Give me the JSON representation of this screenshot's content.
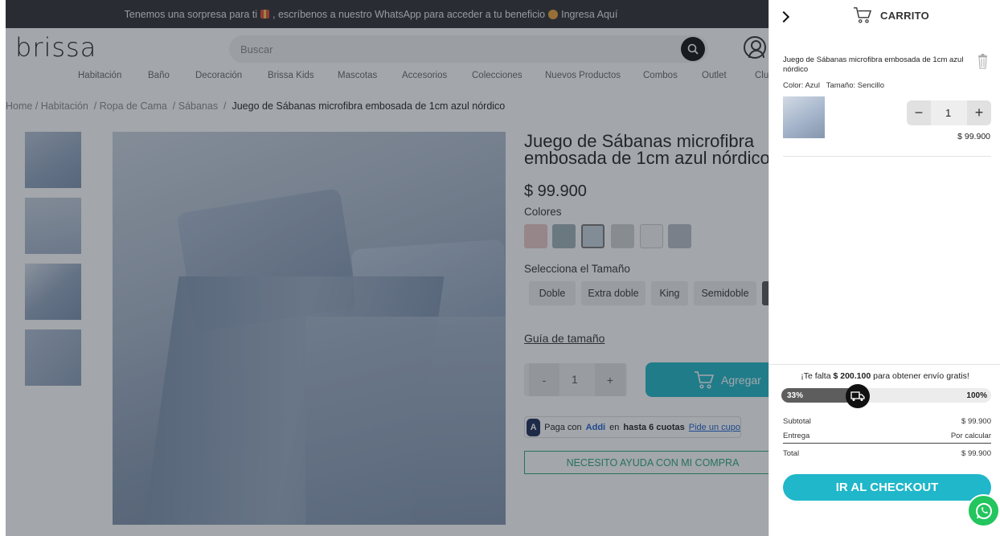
{
  "promo": {
    "text_before": "Tenemos una sorpresa para ti",
    "text_middle": ", escríbenos a nuestro WhatsApp para acceder a tu beneficio",
    "link": "Ingresa Aquí"
  },
  "header": {
    "logo": "brissa",
    "search_placeholder": "Buscar"
  },
  "nav": [
    "Habitación",
    "Baño",
    "Decoración",
    "Brissa Kids",
    "Mascotas",
    "Accesorios",
    "Colecciones",
    "Nuevos Productos",
    "Combos",
    "Outlet",
    "Clu"
  ],
  "breadcrumb": {
    "items": [
      "Home",
      "/ Habitación",
      "/ Ropa de Cama",
      "/ Sábanas",
      "/"
    ],
    "current": "Juego de Sábanas microfibra embosada de 1cm azul nórdico"
  },
  "product": {
    "title": "Juego de Sábanas microfibra embosada de 1cm azul nórdico",
    "price": "$ 99.900",
    "colors_label": "Colores",
    "colors": [
      "#e8c7c7",
      "#9db2b6",
      "#c4d2df",
      "#cfd2d4",
      "#f4f6f8",
      "#b7bec6"
    ],
    "size_label": "Selecciona el Tamaño",
    "sizes": [
      "Doble",
      "Extra doble",
      "King",
      "Semidoble"
    ],
    "size_guide": "Guía de tamaño",
    "qty_minus": "-",
    "qty_value": "1",
    "qty_plus": "+",
    "add_label": "Agregar",
    "addi_prefix": "Paga con",
    "addi_brand": "Addi",
    "addi_mid": "en",
    "addi_bold": "hasta 6 cuotas",
    "addi_link": "Pide un cupo",
    "addi_logo": "A",
    "help": "NECESITO AYUDA CON MI COMPRA"
  },
  "cart": {
    "title": "CARRITO",
    "item_name": "Juego de Sábanas microfibra embosada de 1cm azul nórdico",
    "color_attr": "Color: Azul",
    "size_attr": "Tamaño: Sencillo",
    "qty_minus": "−",
    "qty": "1",
    "qty_plus": "+",
    "line_price": "$ 99.900",
    "ship_prefix": "¡Te falta",
    "ship_amount": "$ 200.100",
    "ship_suffix": "para obtener envío gratis!",
    "progress_label": "33%",
    "progress_fraction": 0.33,
    "progress_max": "100%",
    "subtotal_label": "Subtotal",
    "subtotal": "$ 99.900",
    "delivery_label": "Entrega",
    "delivery": "Por calcular",
    "total_label": "Total",
    "total": "$ 99.900",
    "checkout": "IR AL CHECKOUT"
  }
}
